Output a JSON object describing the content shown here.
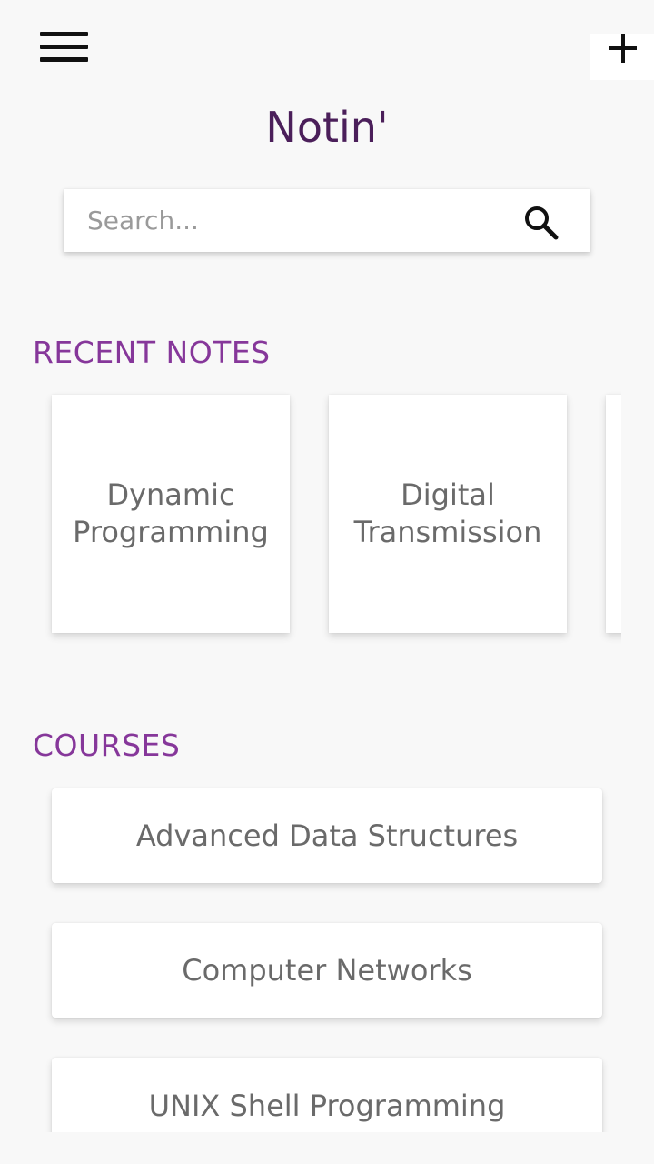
{
  "header": {
    "menu_icon": "hamburger-menu-icon",
    "add_icon": "plus-icon",
    "app_title": "Notin'"
  },
  "search": {
    "placeholder": "Search...",
    "value": "",
    "icon": "search-icon"
  },
  "recent_notes": {
    "title": "RECENT NOTES",
    "items": [
      {
        "label": "Dynamic Programming"
      },
      {
        "label": "Digital Transmission"
      },
      {
        "label": ""
      }
    ]
  },
  "courses": {
    "title": "COURSES",
    "items": [
      {
        "label": "Advanced Data Structures"
      },
      {
        "label": "Computer Networks"
      },
      {
        "label": "UNIX Shell Programming"
      }
    ]
  },
  "colors": {
    "title": "#4b1f5a",
    "section_heading": "#86379a",
    "background": "#f8f8f8",
    "card_text": "#6a6a6a"
  }
}
